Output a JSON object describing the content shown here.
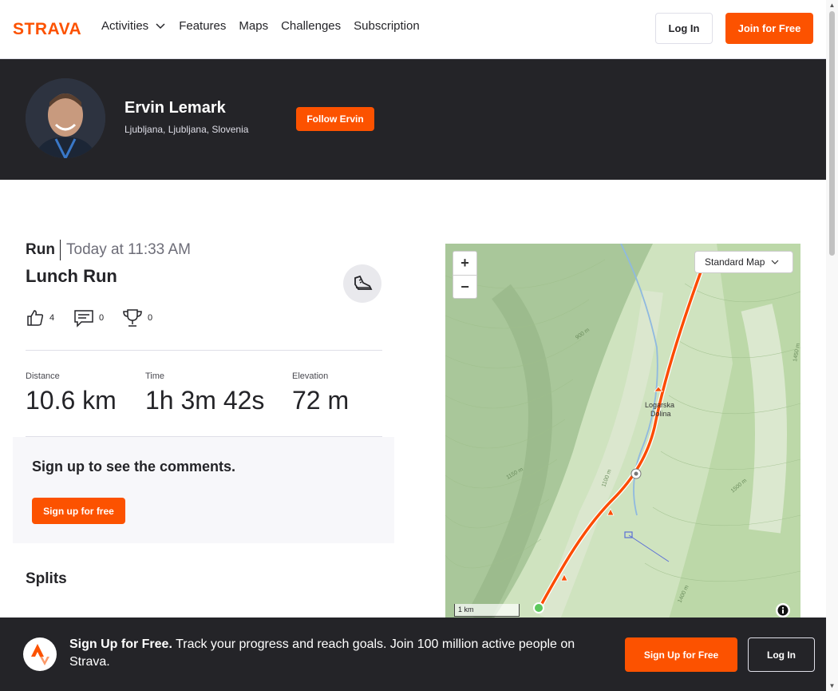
{
  "nav": {
    "logo": "STRAVA",
    "links": [
      "Activities",
      "Features",
      "Maps",
      "Challenges",
      "Subscription"
    ],
    "login": "Log In",
    "join": "Join for Free"
  },
  "athlete": {
    "name": "Ervin Lemark",
    "location": "Ljubljana, Ljubljana, Slovenia",
    "follow": "Follow Ervin"
  },
  "activity": {
    "type": "Run",
    "date": "Today at 11:33 AM",
    "name": "Lunch Run",
    "kudos": "4",
    "comments": "0",
    "achievements": "0"
  },
  "stats": [
    {
      "label": "Distance",
      "value": "10.6 km"
    },
    {
      "label": "Time",
      "value": "1h 3m 42s"
    },
    {
      "label": "Elevation",
      "value": "72 m"
    }
  ],
  "comments_section": {
    "title": "Sign up to see the comments.",
    "button": "Sign up for free"
  },
  "splits": {
    "title": "Splits"
  },
  "map": {
    "style": "Standard Map",
    "zoom_in": "+",
    "zoom_out": "−",
    "scale": "1 km",
    "place_label_1": "Logarska",
    "place_label_2": "Dolina",
    "contours": [
      "900 m",
      "1150 m",
      "1500 m",
      "1100 m",
      "1400 m",
      "1450 m"
    ]
  },
  "footer": {
    "title": "Sign Up for Free.",
    "text": "Track your progress and reach goals. Join 100 million active people on Strava.",
    "signup": "Sign Up for Free",
    "login": "Log In"
  },
  "colors": {
    "brand": "#fc5200",
    "dark": "#242428"
  }
}
